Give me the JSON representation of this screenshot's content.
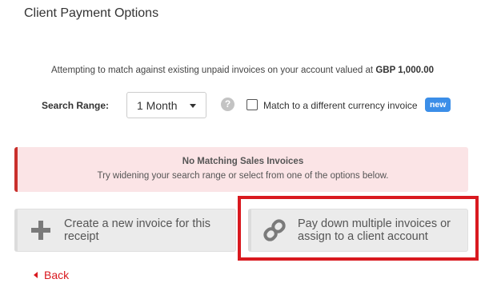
{
  "page": {
    "title": "Client Payment Options"
  },
  "match_info": {
    "prefix": "Attempting to match against existing unpaid invoices on your account valued at",
    "amount": "GBP 1,000.00"
  },
  "search": {
    "label": "Search Range:",
    "selected": "1 Month",
    "help_glyph": "?",
    "currency_checkbox_label": "Match to a different currency invoice",
    "currency_checked": false,
    "new_badge": "new"
  },
  "alert": {
    "title": "No Matching Sales Invoices",
    "text": "Try widening your search range or select from one of the options below."
  },
  "options": [
    {
      "icon": "plus-icon",
      "label": "Create a new invoice for this receipt"
    },
    {
      "icon": "link-icon",
      "label": "Pay down multiple invoices or assign to a client account"
    }
  ],
  "back": {
    "label": "Back"
  },
  "colors": {
    "accent_red": "#d9191f",
    "alert_bg": "#fbe4e6",
    "badge_blue": "#3b8ee8",
    "card_bg": "#ebebeb"
  }
}
